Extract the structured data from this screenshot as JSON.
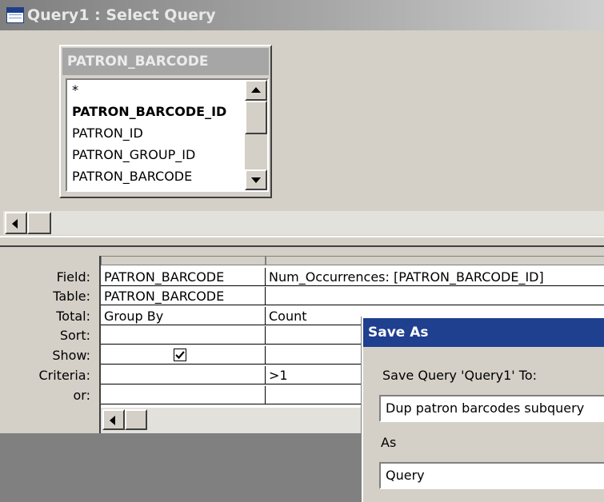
{
  "window": {
    "title": "Query1 : Select Query"
  },
  "field_list": {
    "table_name": "PATRON_BARCODE",
    "fields": [
      "*",
      "PATRON_BARCODE_ID",
      "PATRON_ID",
      "PATRON_GROUP_ID",
      "PATRON_BARCODE"
    ],
    "bold_field": "PATRON_BARCODE_ID"
  },
  "design_grid": {
    "row_labels": [
      "Field:",
      "Table:",
      "Total:",
      "Sort:",
      "Show:",
      "Criteria:",
      "or:"
    ],
    "columns": [
      {
        "field": "PATRON_BARCODE",
        "table": "PATRON_BARCODE",
        "total": "Group By",
        "sort": "",
        "show": true,
        "criteria": "",
        "or": ""
      },
      {
        "field": "Num_Occurrences: [PATRON_BARCODE_ID]",
        "table": "",
        "total": "Count",
        "sort": "",
        "show": false,
        "criteria": ">1",
        "or": ""
      }
    ]
  },
  "save_dialog": {
    "title": "Save As",
    "prompt": "Save Query 'Query1' To:",
    "name_value": "Dup patron barcodes subquery",
    "as_label": "As",
    "type_value": "Query"
  },
  "icons": {
    "window_icon": "query-window-icon",
    "check": "checkmark-icon"
  }
}
